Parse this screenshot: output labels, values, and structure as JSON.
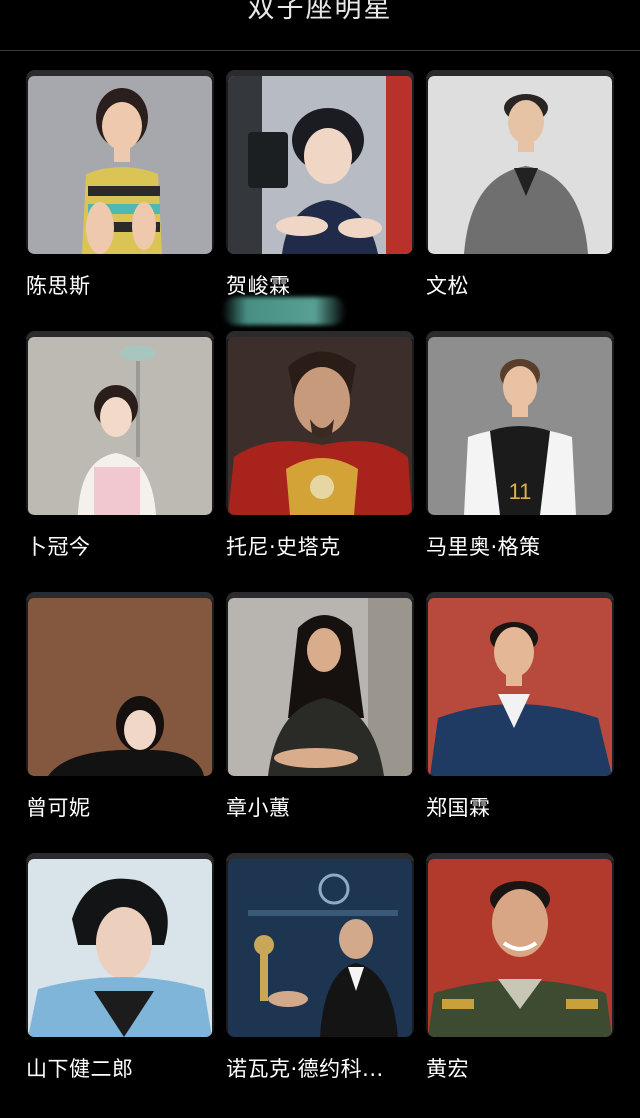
{
  "header": {
    "title": "双子座明星"
  },
  "celebrities": [
    {
      "name": "陈思斯",
      "bg": "#a6a8ad"
    },
    {
      "name": "贺峻霖",
      "bg": "#b7bcc4"
    },
    {
      "name": "文松",
      "bg": "#dedede"
    },
    {
      "name": "卜冠今",
      "bg": "#bdb9b3"
    },
    {
      "name": "托尼·史塔克",
      "bg": "#3c2e2b"
    },
    {
      "name": "马里奥·格策",
      "bg": "#8e8e8e"
    },
    {
      "name": "曾可妮",
      "bg": "#8a5c44"
    },
    {
      "name": "章小蕙",
      "bg": "#b8b5b0"
    },
    {
      "name": "郑国霖",
      "bg": "#b84a3d"
    },
    {
      "name": "山下健二郎",
      "bg": "#d8e3ea"
    },
    {
      "name": "诺瓦克·德约科...",
      "bg": "#1d3550"
    },
    {
      "name": "黄宏",
      "bg": "#b23a2c"
    }
  ]
}
